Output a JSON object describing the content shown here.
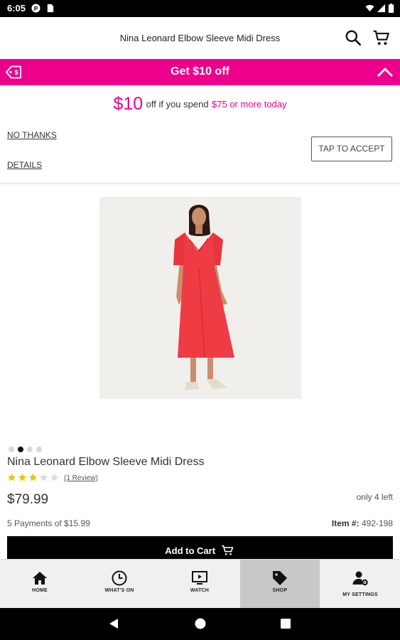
{
  "status_bar": {
    "time": "6:05"
  },
  "header": {
    "title": "Nina Leonard Elbow Sleeve Midi Dress",
    "icons": [
      "search-icon",
      "cart-icon"
    ]
  },
  "promo": {
    "title": "Get $10 off",
    "icons": [
      "tag-icon",
      "chevron-up-icon"
    ],
    "color": "#ec008c"
  },
  "offer": {
    "amount": "$10",
    "middle_text": "off if you spend",
    "min_spend": "$75 or more today",
    "no_thanks": "NO THANKS",
    "details": "DETAILS",
    "accept": "TAP TO ACCEPT"
  },
  "product": {
    "name": "Nina Leonard Elbow Sleeve Midi Dress",
    "rating": 3,
    "rating_max": 5,
    "reviews": "(1 Review)",
    "price": "$79.99",
    "stock": "only 4 left",
    "payments": "5 Payments of $15.99",
    "item_label": "Item #:",
    "item_number": "492-198",
    "image_dots_count": 4,
    "image_dots_active": 1,
    "add_to_cart": "Add to Cart"
  },
  "bottom_nav": {
    "active": "shop",
    "items": [
      {
        "id": "home",
        "label": "HOME",
        "icon": "home-icon"
      },
      {
        "id": "whats_on",
        "label": "WHAT'S ON",
        "icon": "clock-icon"
      },
      {
        "id": "watch",
        "label": "WATCH",
        "icon": "tv-play-icon"
      },
      {
        "id": "shop",
        "label": "SHOP",
        "icon": "tag-icon"
      },
      {
        "id": "settings",
        "label": "MY SETTINGS",
        "icon": "user-gear-icon"
      }
    ]
  },
  "colors": {
    "accent": "#ec008c",
    "star": "#f2c200",
    "button": "#000000"
  }
}
